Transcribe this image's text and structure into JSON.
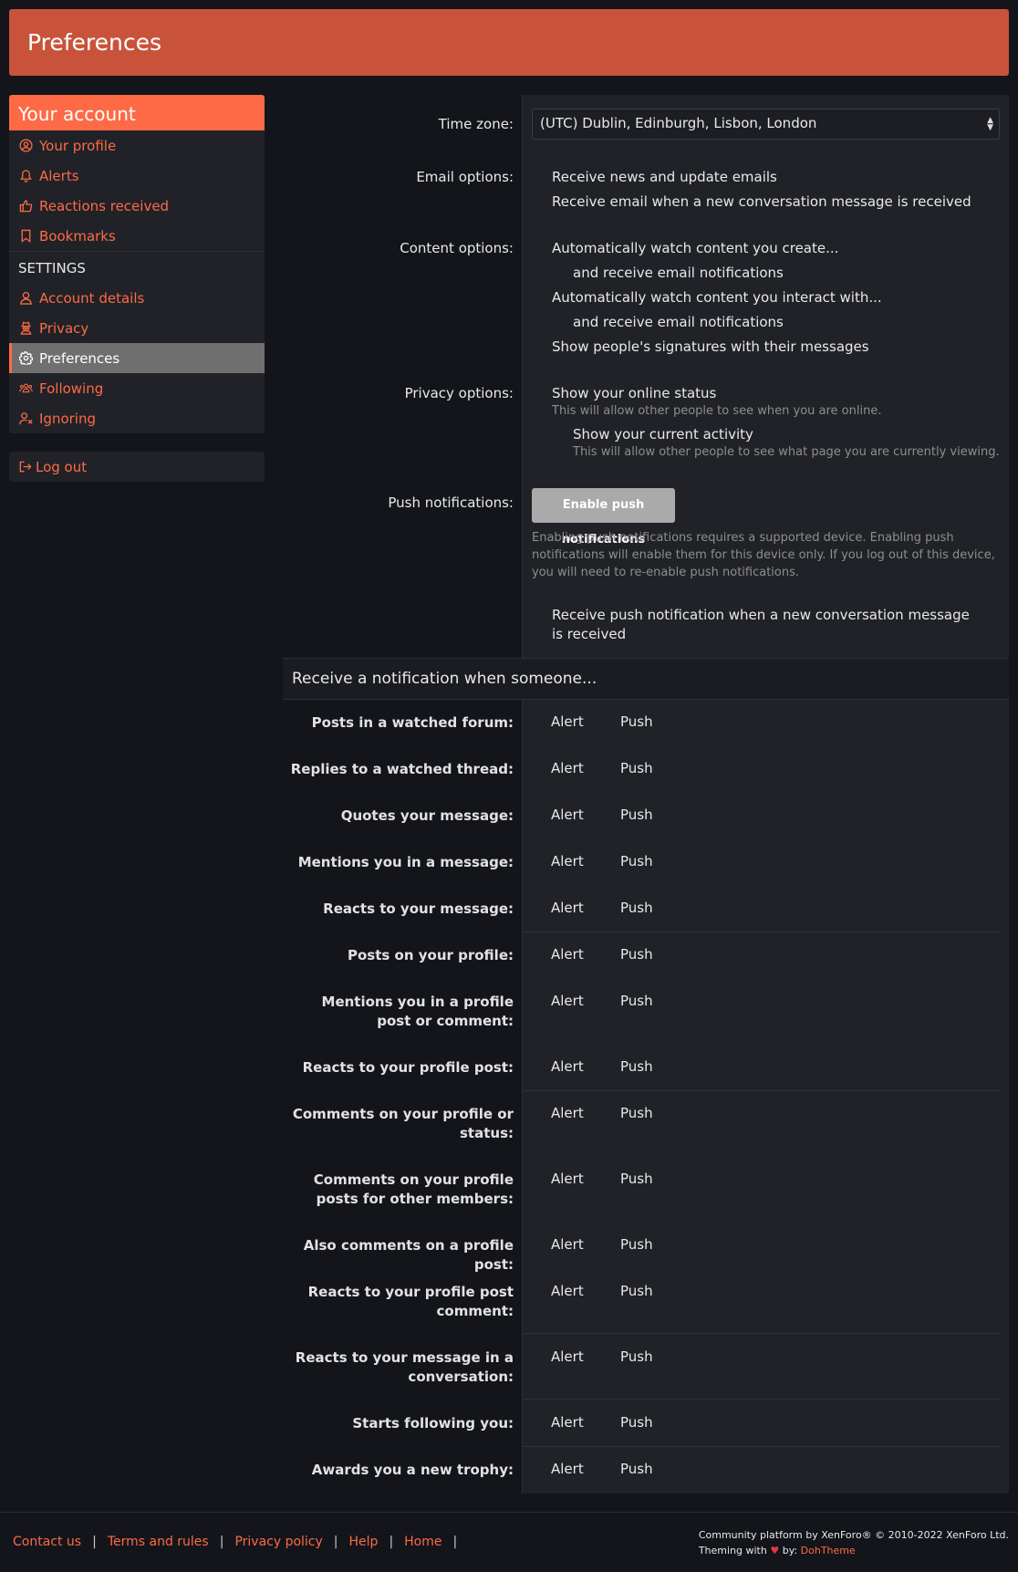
{
  "header": {
    "title": "Preferences"
  },
  "sidebar": {
    "title": "Your account",
    "items": [
      {
        "label": "Your profile",
        "icon": "user-circle-icon"
      },
      {
        "label": "Alerts",
        "icon": "bell-icon"
      },
      {
        "label": "Reactions received",
        "icon": "thumbs-up-icon"
      },
      {
        "label": "Bookmarks",
        "icon": "bookmark-icon"
      }
    ],
    "settings_heading": "SETTINGS",
    "settings_items": [
      {
        "label": "Account details",
        "icon": "user-icon"
      },
      {
        "label": "Privacy",
        "icon": "user-secret-icon"
      },
      {
        "label": "Preferences",
        "icon": "gear-icon",
        "active": true
      },
      {
        "label": "Following",
        "icon": "users-icon"
      },
      {
        "label": "Ignoring",
        "icon": "user-times-icon"
      }
    ],
    "logout": "Log out"
  },
  "form": {
    "timezone": {
      "label": "Time zone:",
      "value": "(UTC) Dublin, Edinburgh, Lisbon, London"
    },
    "email": {
      "label": "Email options:",
      "options": [
        "Receive news and update emails",
        "Receive email when a new conversation message is received"
      ]
    },
    "content": {
      "label": "Content options:",
      "opt1": "Automatically watch content you create...",
      "opt1_sub": "and receive email notifications",
      "opt2": "Automatically watch content you interact with...",
      "opt2_sub": "and receive email notifications",
      "opt3": "Show people's signatures with their messages"
    },
    "privacy": {
      "label": "Privacy options:",
      "opt1": "Show your online status",
      "opt1_hint": "This will allow other people to see when you are online.",
      "opt2": "Show your current activity",
      "opt2_hint": "This will allow other people to see what page you are currently viewing."
    },
    "push": {
      "label": "Push notifications:",
      "button": "Enable push notifications",
      "hint": "Enabling push notifications requires a supported device. Enabling push notifications will enable them for this device only. If you log out of this device, you will need to re-enable push notifications.",
      "opt": "Receive push notification when a new conversation message is received"
    }
  },
  "notifications": {
    "heading": "Receive a notification when someone...",
    "alert_label": "Alert",
    "push_label": "Push",
    "rows": [
      "Posts in a watched forum:",
      "Replies to a watched thread:",
      "Quotes your message:",
      "Mentions you in a message:",
      "Reacts to your message:",
      "Posts on your profile:",
      "Mentions you in a profile post or comment:",
      "Reacts to your profile post:",
      "Comments on your profile or status:",
      "Comments on your profile posts for other members:",
      "Also comments on a profile post:",
      "Reacts to your profile post comment:",
      "Reacts to your message in a conversation:",
      "Starts following you:",
      "Awards you a new trophy:"
    ]
  },
  "footer": {
    "links": [
      "Contact us",
      "Terms and rules",
      "Privacy policy",
      "Help",
      "Home"
    ],
    "credit_line1": "Community platform by XenForo® © 2010-2022 XenForo Ltd.",
    "credit_theming": "Theming with",
    "credit_by": "by:",
    "credit_author": "DohTheme"
  },
  "colors": {
    "accent": "#fe6a45",
    "header": "#c9533a",
    "background": "#13151b",
    "panel": "#202228"
  }
}
